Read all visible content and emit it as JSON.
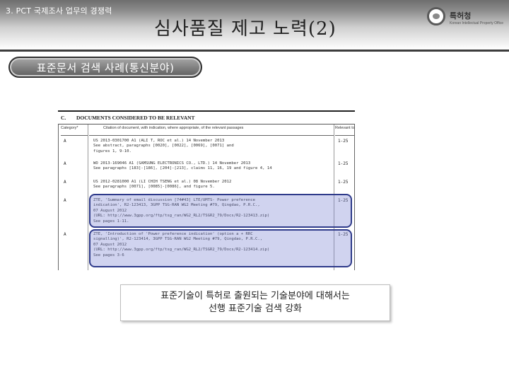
{
  "header": {
    "section_label": "3. PCT 국제조사 업무의 경쟁력",
    "title": "심사품질 제고 노력(2)",
    "logo": {
      "name": "특허청",
      "subtitle": "Korean Intellectual Property Office",
      "icon": "kipo-emblem-icon"
    }
  },
  "subtitle": "표준문서 검색 사례(통신분야)",
  "document": {
    "section_letter": "C.",
    "section_title": "DOCUMENTS CONSIDERED TO BE RELEVANT",
    "columns": [
      "Category*",
      "Citation of document, with indication, where appropriate, of the relevant passages",
      "Relevant to claim No."
    ],
    "rows": [
      {
        "category": "A",
        "citation": "US 2013-0301700 A1 (ALI T, ROC et al.) 14 November 2013\nSee abstract, paragraphs [0020], [0022], [0069], [0071] and\nfigures 1, 9-10.",
        "relevant": "1-25"
      },
      {
        "category": "A",
        "citation": "WO 2013-169046 A1 (SAMSUNG ELECTRONICS CO., LTD.) 14 November 2013\nSee paragraphs [183]-[186], [204]-[213], claims 11, 16, 19 and figure 4, 14",
        "relevant": "1-25"
      },
      {
        "category": "A",
        "citation": "US 2012-0281000 A1 (LI CHIH TSENG et al.) 08 November 2012\nSee paragraphs [0071], [0085]-[0086], and figure 5.",
        "relevant": "1-25"
      },
      {
        "category": "A",
        "citation": "ZTE, 'Summary of email discussion [74#43] LTE/UMTS- Power preference\nindication', R2-123413, 3GPP TSG-RAN WG2 Meeting #79, Qingdao, P.R.C.,\n07 August 2012\n(URL: http://www.3gpp.org/ftp/tsg_ran/WG2_RL2/TSGR2_79/Docs/R2-123413.zip)\nSee pages 1-11.",
        "relevant": "1-25",
        "highlight": true
      },
      {
        "category": "A",
        "citation": "ZTE, 'Introduction of 'Power preference indication' (option a + RRC\nsignalling)', R2-123414, 3GPP TSG-RAN WG2 Meeting #79, Qingdao, P.R.C.,\n07 August 2012\n(URL: http://www.3gpp.org/ftp/tsg_ran/WG2_RL2/TSGR2_79/Docs/R2-123414.zip)\nSee pages 3-6",
        "relevant": "1-25",
        "highlight": true
      }
    ]
  },
  "caption": {
    "line1": "표준기술이 특허로 출원되는 기술분야에 대해서는",
    "line2": "선행 표준기술 검색 강화"
  },
  "colors": {
    "highlight_border": "#2e3a8a",
    "highlight_fill": "#9aa2dd",
    "pill": "#6e6e6e"
  }
}
